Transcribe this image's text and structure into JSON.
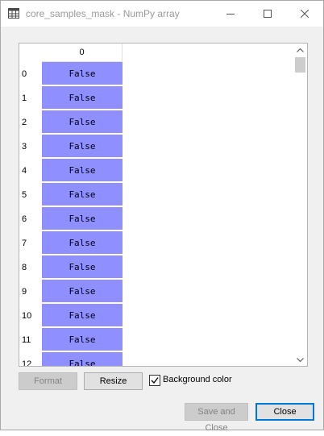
{
  "window": {
    "title": "core_samples_mask - NumPy array"
  },
  "table": {
    "column_headers": [
      "0"
    ],
    "rows": [
      {
        "index": "0",
        "value": "False"
      },
      {
        "index": "1",
        "value": "False"
      },
      {
        "index": "2",
        "value": "False"
      },
      {
        "index": "3",
        "value": "False"
      },
      {
        "index": "4",
        "value": "False"
      },
      {
        "index": "5",
        "value": "False"
      },
      {
        "index": "6",
        "value": "False"
      },
      {
        "index": "7",
        "value": "False"
      },
      {
        "index": "8",
        "value": "False"
      },
      {
        "index": "9",
        "value": "False"
      },
      {
        "index": "10",
        "value": "False"
      },
      {
        "index": "11",
        "value": "False"
      },
      {
        "index": "12",
        "value": "False"
      }
    ],
    "cell_color": "#8f8fff"
  },
  "toolbar": {
    "format_label": "Format",
    "resize_label": "Resize",
    "background_color_label": "Background color",
    "background_color_checked": true
  },
  "footer": {
    "save_close_label": "Save and Close",
    "close_label": "Close"
  },
  "icons": {
    "app": "table-icon",
    "minimize": "minimize-icon",
    "maximize": "maximize-icon",
    "close": "close-icon",
    "scroll_up": "chevron-up-icon",
    "scroll_down": "chevron-down-icon",
    "checkmark": "checkmark-icon"
  }
}
